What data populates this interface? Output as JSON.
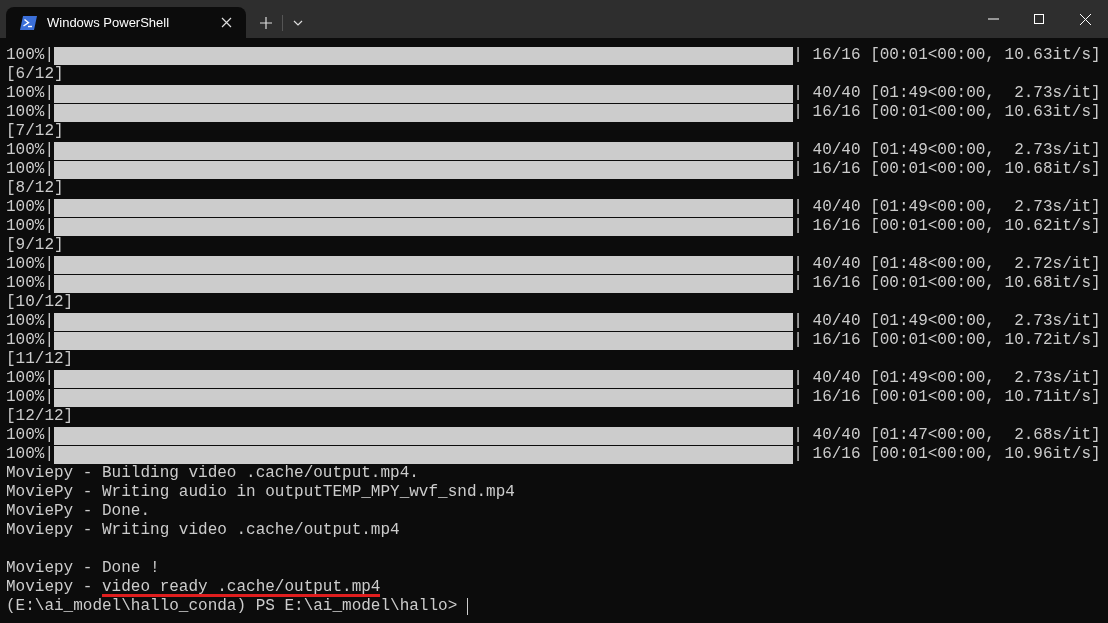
{
  "tabs": [
    {
      "title": "Windows PowerShell",
      "selected": true
    }
  ],
  "lines": [
    {
      "kind": "progress",
      "prefix": "100%|",
      "level": 1,
      "suffix": "| 16/16 [00:01<00:00, 10.63it/s]"
    },
    {
      "kind": "text",
      "text": "[6/12]"
    },
    {
      "kind": "progress",
      "prefix": "100%|",
      "level": 1,
      "suffix": "| 40/40 [01:49<00:00,  2.73s/it]"
    },
    {
      "kind": "progress",
      "prefix": "100%|",
      "level": 1,
      "suffix": "| 16/16 [00:01<00:00, 10.63it/s]"
    },
    {
      "kind": "text",
      "text": "[7/12]"
    },
    {
      "kind": "progress",
      "prefix": "100%|",
      "level": 1,
      "suffix": "| 40/40 [01:49<00:00,  2.73s/it]"
    },
    {
      "kind": "progress",
      "prefix": "100%|",
      "level": 1,
      "suffix": "| 16/16 [00:01<00:00, 10.68it/s]"
    },
    {
      "kind": "text",
      "text": "[8/12]"
    },
    {
      "kind": "progress",
      "prefix": "100%|",
      "level": 1,
      "suffix": "| 40/40 [01:49<00:00,  2.73s/it]"
    },
    {
      "kind": "progress",
      "prefix": "100%|",
      "level": 1,
      "suffix": "| 16/16 [00:01<00:00, 10.62it/s]"
    },
    {
      "kind": "text",
      "text": "[9/12]"
    },
    {
      "kind": "progress",
      "prefix": "100%|",
      "level": 1,
      "suffix": "| 40/40 [01:48<00:00,  2.72s/it]"
    },
    {
      "kind": "progress",
      "prefix": "100%|",
      "level": 1,
      "suffix": "| 16/16 [00:01<00:00, 10.68it/s]"
    },
    {
      "kind": "text",
      "text": "[10/12]"
    },
    {
      "kind": "progress",
      "prefix": "100%|",
      "level": 1,
      "suffix": "| 40/40 [01:49<00:00,  2.73s/it]"
    },
    {
      "kind": "progress",
      "prefix": "100%|",
      "level": 1,
      "suffix": "| 16/16 [00:01<00:00, 10.72it/s]"
    },
    {
      "kind": "text",
      "text": "[11/12]"
    },
    {
      "kind": "progress",
      "prefix": "100%|",
      "level": 1,
      "suffix": "| 40/40 [01:49<00:00,  2.73s/it]"
    },
    {
      "kind": "progress",
      "prefix": "100%|",
      "level": 1,
      "suffix": "| 16/16 [00:01<00:00, 10.71it/s]"
    },
    {
      "kind": "text",
      "text": "[12/12]"
    },
    {
      "kind": "progress",
      "prefix": "100%|",
      "level": 1,
      "suffix": "| 40/40 [01:47<00:00,  2.68s/it]"
    },
    {
      "kind": "progress",
      "prefix": "100%|",
      "level": 1,
      "suffix": "| 16/16 [00:01<00:00, 10.96it/s]"
    },
    {
      "kind": "text",
      "text": "Moviepy - Building video .cache/output.mp4."
    },
    {
      "kind": "text",
      "text": "MoviePy - Writing audio in outputTEMP_MPY_wvf_snd.mp4"
    },
    {
      "kind": "text",
      "text": "MoviePy - Done."
    },
    {
      "kind": "text",
      "text": "Moviepy - Writing video .cache/output.mp4"
    },
    {
      "kind": "blank"
    },
    {
      "kind": "text",
      "text": "Moviepy - Done !"
    },
    {
      "kind": "underlined",
      "prefix": "Moviepy - ",
      "marked": "video ready .cache/output.mp4"
    },
    {
      "kind": "prompt",
      "text": "(E:\\ai_model\\hallo_conda) PS E:\\ai_model\\hallo>"
    }
  ]
}
